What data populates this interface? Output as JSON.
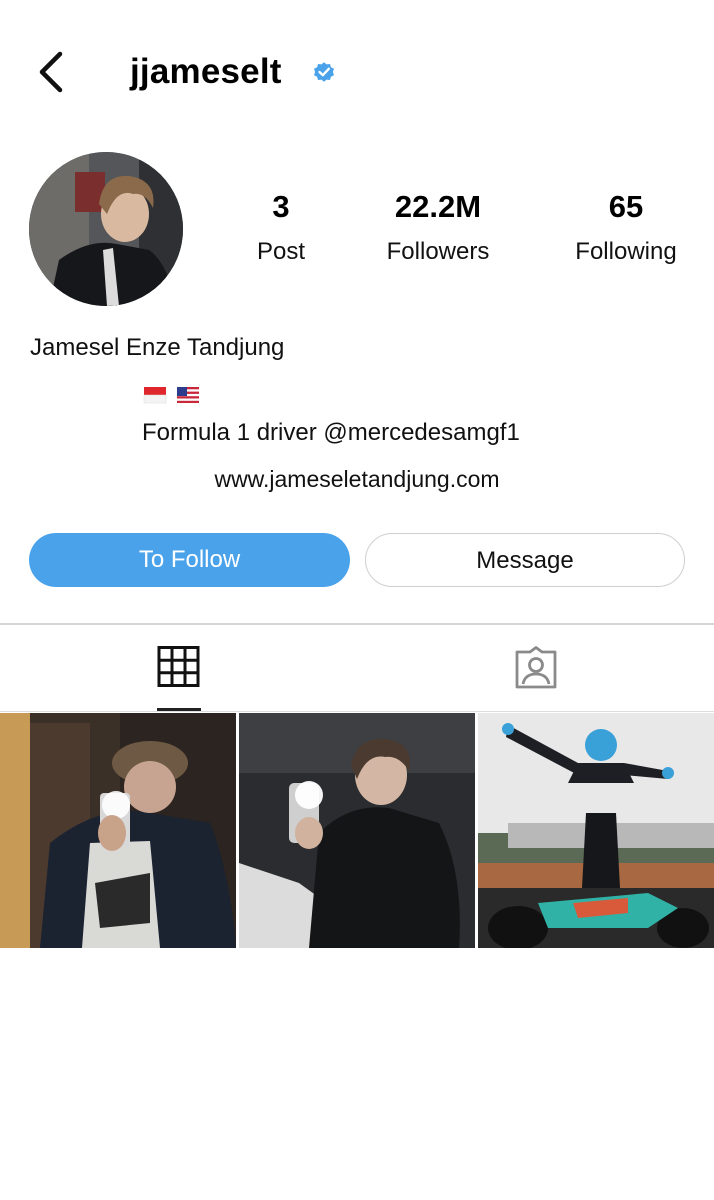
{
  "header": {
    "username": "jjameselt",
    "back_icon": "chevron-left-icon",
    "verified_icon": "verified-badge-icon",
    "verified_color": "#4aa3ea"
  },
  "profile": {
    "stats": [
      {
        "value": "3",
        "label": "Post"
      },
      {
        "value": "22.2M",
        "label": "Followers"
      },
      {
        "value": "65",
        "label": "Following"
      }
    ],
    "full_name": "Jamesel Enze Tandjung",
    "flags": [
      "indonesia-flag-icon",
      "usa-flag-icon"
    ],
    "bio": "Formula 1 driver @mercedesamgf1",
    "website": "www.jameseletandjung.com"
  },
  "actions": {
    "follow_label": "To Follow",
    "message_label": "Message",
    "follow_color": "#4aa3ea"
  },
  "tabs": [
    {
      "icon": "grid-icon",
      "selected": true
    },
    {
      "icon": "tagged-person-icon",
      "selected": false
    }
  ],
  "posts": [
    {
      "icon": "photo-mirror-selfie-cap"
    },
    {
      "icon": "photo-mirror-selfie-jacket"
    },
    {
      "icon": "photo-driver-on-car"
    }
  ]
}
